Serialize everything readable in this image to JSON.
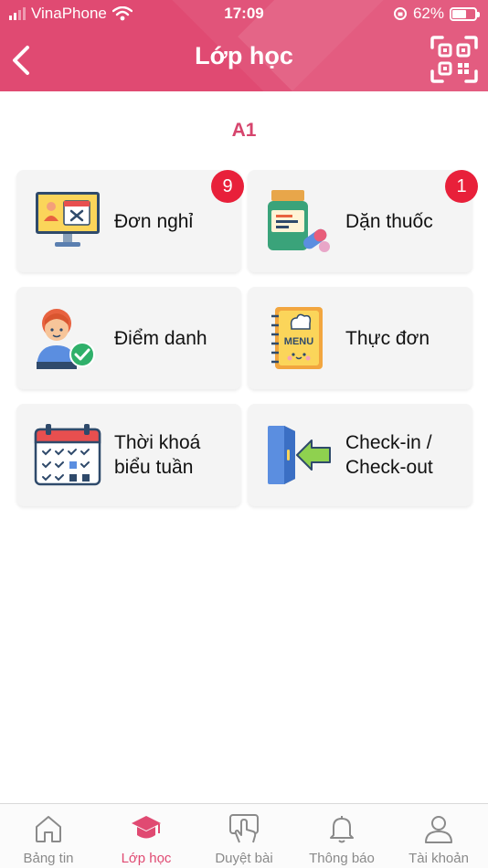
{
  "status_bar": {
    "carrier": "VinaPhone",
    "time": "17:09",
    "battery": "62%",
    "battery_level": 0.62
  },
  "header": {
    "title": "Lớp học"
  },
  "class_name": "A1",
  "features": [
    {
      "label": "Đơn nghỉ",
      "badge": "9",
      "icon": "leave-request-icon"
    },
    {
      "label": "Dặn thuốc",
      "badge": "1",
      "icon": "medicine-icon"
    },
    {
      "label": "Điểm danh",
      "badge": "",
      "icon": "attendance-icon"
    },
    {
      "label": "Thực đơn",
      "badge": "",
      "icon": "menu-book-icon"
    },
    {
      "label": "Thời khoá\nbiểu tuần",
      "badge": "",
      "icon": "calendar-icon"
    },
    {
      "label": "Check-in /\nCheck-out",
      "badge": "",
      "icon": "check-in-door-icon"
    }
  ],
  "tabs": [
    {
      "label": "Bảng tin",
      "icon": "home-icon",
      "active": false
    },
    {
      "label": "Lớp học",
      "icon": "graduation-cap-icon",
      "active": true
    },
    {
      "label": "Duyệt bài",
      "icon": "hand-tap-icon",
      "active": false
    },
    {
      "label": "Thông báo",
      "icon": "bell-icon",
      "active": false
    },
    {
      "label": "Tài khoản",
      "icon": "user-icon",
      "active": false
    }
  ],
  "colors": {
    "accent": "#e04a72",
    "badge": "#e8203a",
    "card": "#f4f4f4"
  }
}
